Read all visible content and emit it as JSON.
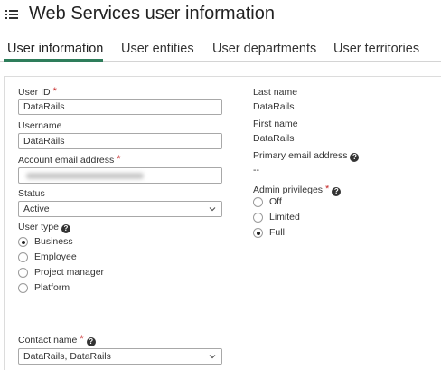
{
  "header": {
    "title": "Web Services user information",
    "menu_icon": "list-menu-icon"
  },
  "tabs": [
    {
      "label": "User information",
      "active": true
    },
    {
      "label": "User entities",
      "active": false
    },
    {
      "label": "User departments",
      "active": false
    },
    {
      "label": "User territories",
      "active": false
    }
  ],
  "accent_color": "#2e7d5b",
  "required_color": "#c62828",
  "form": {
    "user_id": {
      "label": "User ID",
      "value": "DataRails",
      "required": "*"
    },
    "username": {
      "label": "Username",
      "value": "DataRails"
    },
    "account_email": {
      "label": "Account email address",
      "required": "*",
      "value_redacted": true
    },
    "status": {
      "label": "Status",
      "value": "Active"
    },
    "user_type": {
      "label": "User type",
      "options": [
        "Business",
        "Employee",
        "Project manager",
        "Platform"
      ],
      "selected": "Business"
    },
    "contact_name": {
      "label": "Contact name",
      "required": "*",
      "value": "DataRails, DataRails"
    }
  },
  "info": {
    "last_name": {
      "label": "Last name",
      "value": "DataRails"
    },
    "first_name": {
      "label": "First name",
      "value": "DataRails"
    },
    "primary_email": {
      "label": "Primary email address",
      "value": "--"
    },
    "admin_privileges": {
      "label": "Admin privileges",
      "required": "*",
      "options": [
        "Off",
        "Limited",
        "Full"
      ],
      "selected": "Full"
    }
  }
}
